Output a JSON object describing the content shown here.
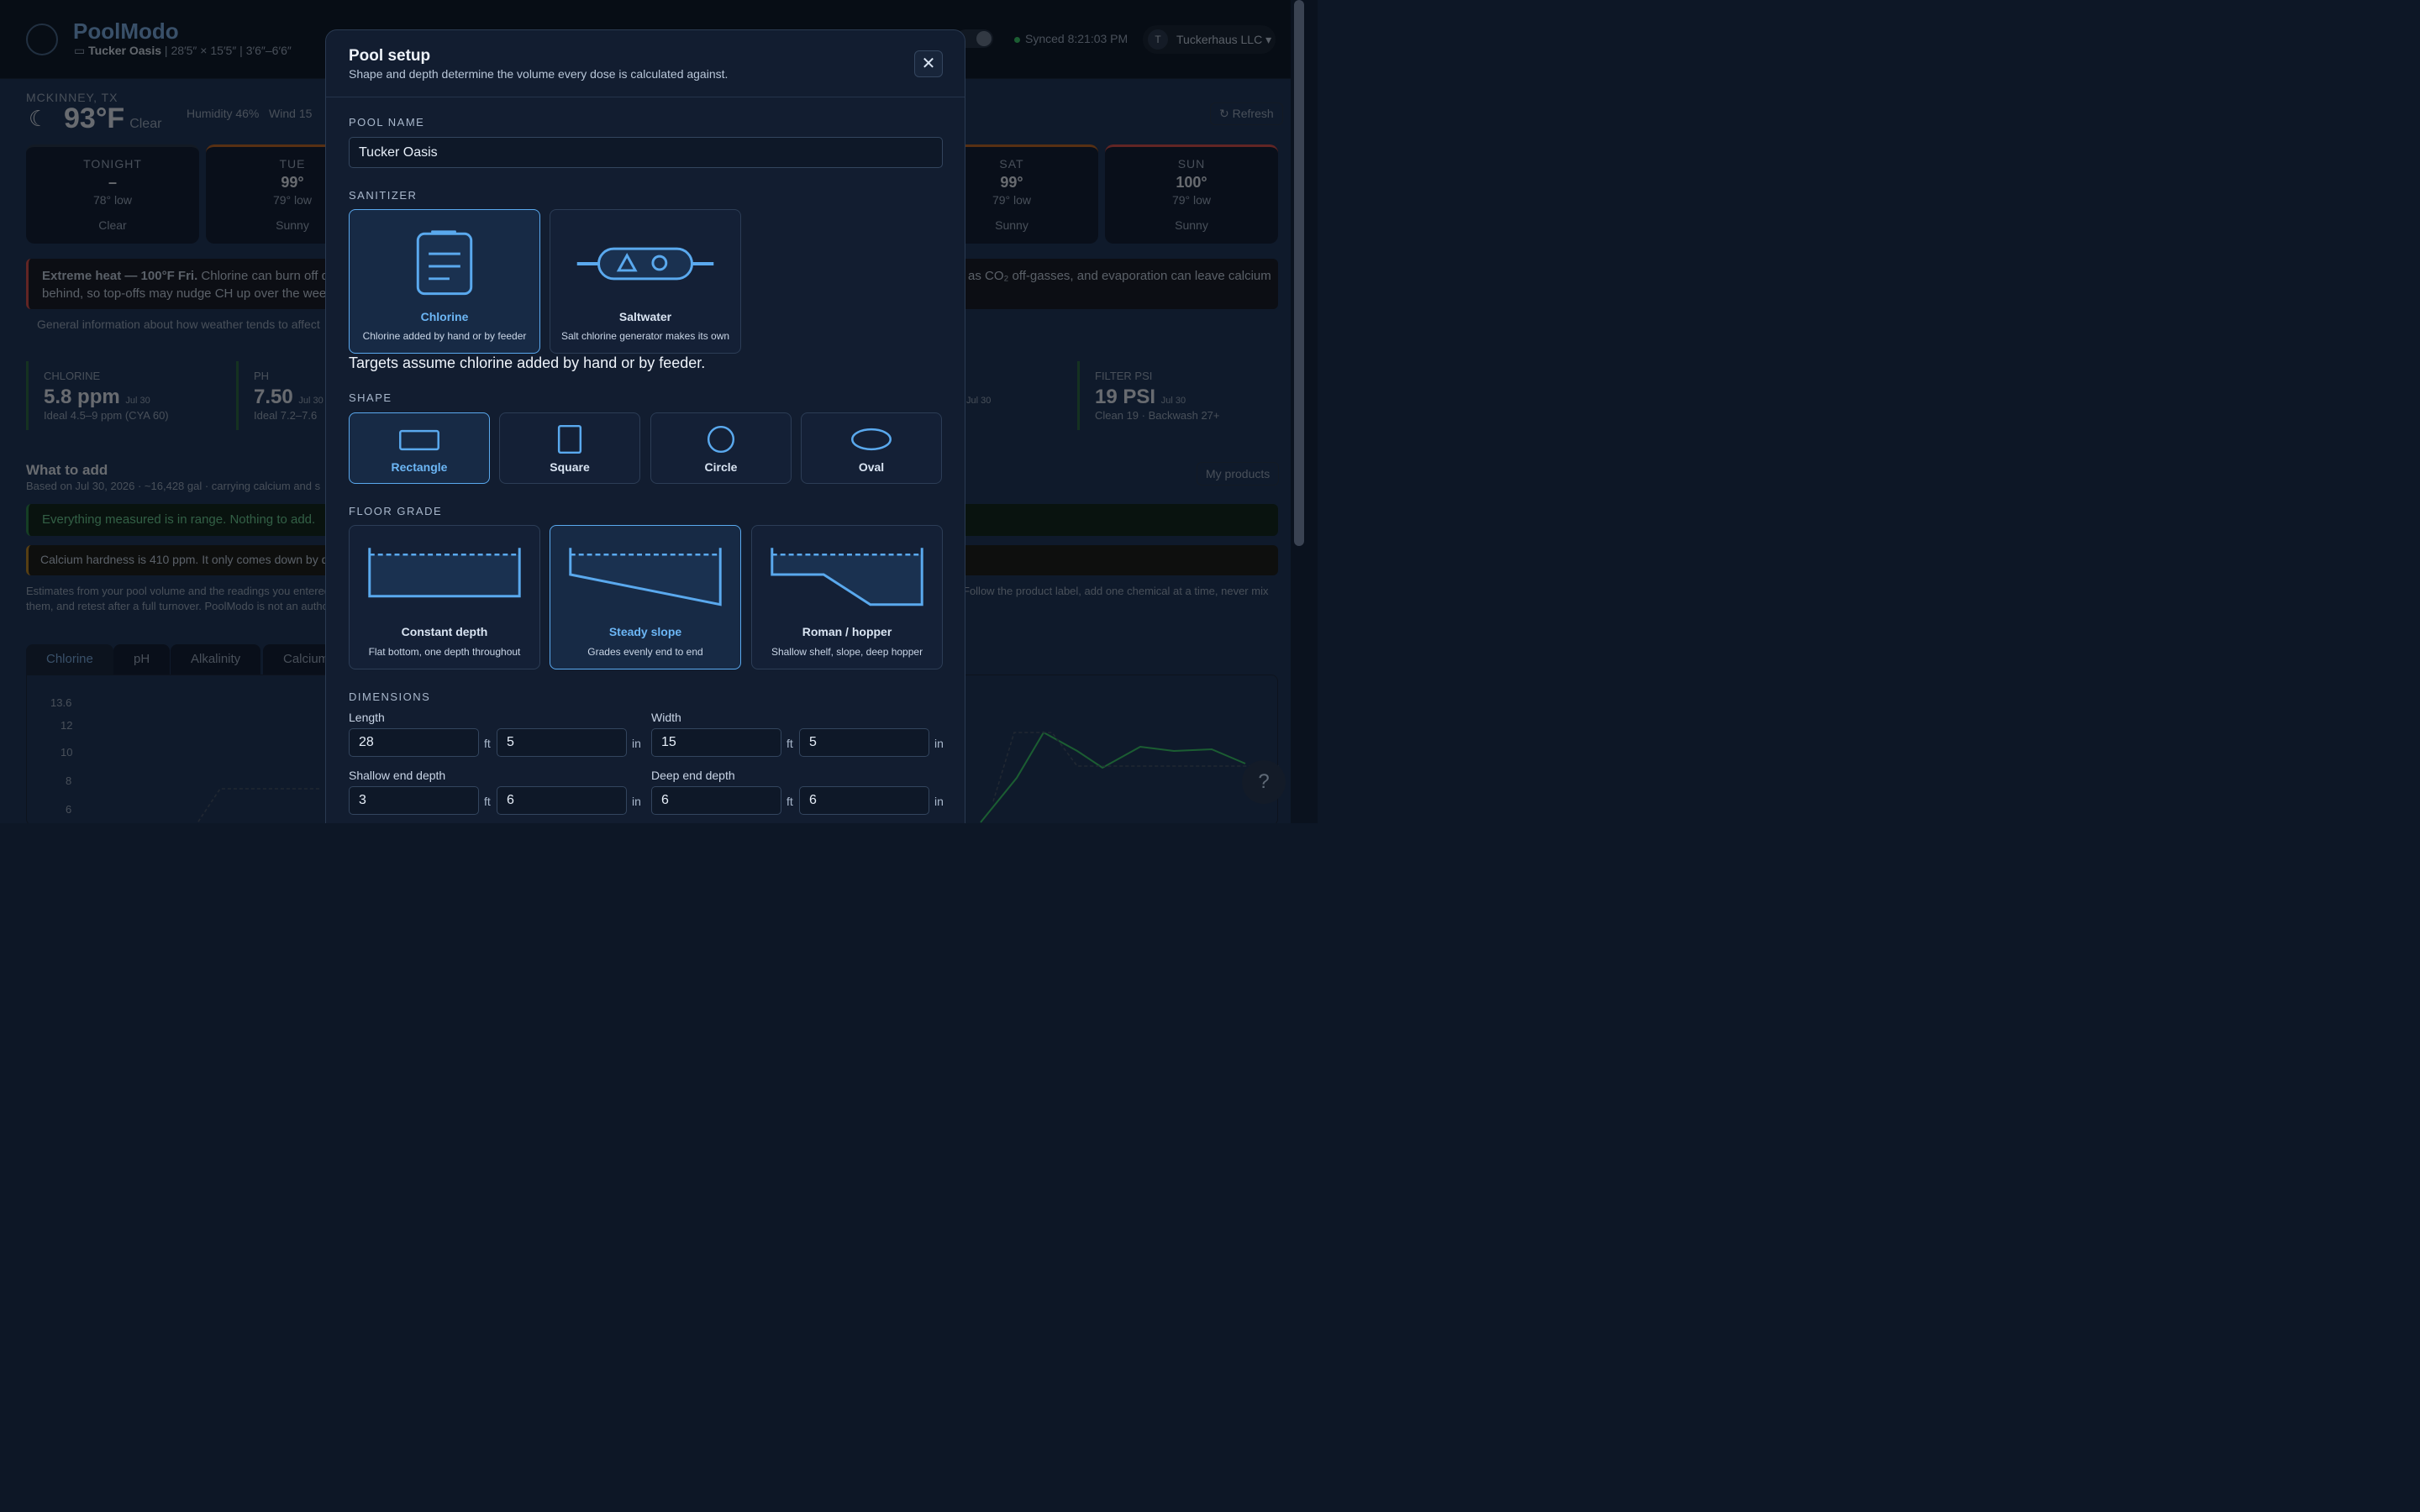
{
  "app": {
    "brand": "PoolModo",
    "pool_label": "Tucker Oasis",
    "dims_text": "28′5″ × 15′5″",
    "depth_text": "3′6″–6′6″",
    "synced": "Synced 8:21:03 PM",
    "account_initial": "T",
    "account_name": "Tuckerhaus LLC"
  },
  "weather": {
    "location": "MCKINNEY, TX",
    "temp": "93°F",
    "cond": "Clear",
    "humidity": "Humidity 46%",
    "wind": "Wind 15",
    "refresh": "↻ Refresh",
    "days": [
      {
        "name": "TONIGHT",
        "hi": "–",
        "lo": "78° low",
        "cond": "Clear"
      },
      {
        "name": "TUE",
        "hi": "99°",
        "lo": "79° low",
        "cond": "Sunny"
      },
      {
        "name": "SAT",
        "hi": "99°",
        "lo": "79° low",
        "cond": "Sunny"
      },
      {
        "name": "SUN",
        "hi": "100°",
        "lo": "79° low",
        "cond": "Sunny"
      }
    ],
    "alert_title": "Extreme heat — 100°F Fri.",
    "alert_text": "Chlorine can burn off q",
    "alert_text2": "behind, so top-offs may nudge CH up over the wee",
    "alert_right": "as CO₂ off-gasses, and evaporation can leave calcium",
    "general_info": "General information about how weather tends to affect"
  },
  "metrics": [
    {
      "label": "CHLORINE",
      "value": "5.8 ppm",
      "date": "Jul 30",
      "ideal": "Ideal 4.5–9 ppm (CYA 60)"
    },
    {
      "label": "PH",
      "value": "7.50",
      "date": "Jul 30",
      "ideal": "Ideal 7.2–7.6"
    },
    {
      "label": "FILTER PSI",
      "value": "19 PSI",
      "date": "Jul 30",
      "ideal": "Clean 19 · Backwash 27+"
    }
  ],
  "metric_extra_date": "Jul 30",
  "add": {
    "title": "What to add",
    "based": "Based on Jul 30, 2026 · ~16,428 gal · carrying calcium and s",
    "my_products": "My products",
    "ok": "Everything measured is in range. Nothing to add.",
    "calcium": "Calcium hardness is 410 ppm. It only comes down by d",
    "estimates": "Estimates from your pool volume and the readings you entered",
    "estimates_right": "Follow the product label, add one chemical at a time, never mix",
    "estimates2": "them, and retest after a full turnover. PoolModo is not an autho"
  },
  "chart_tabs": [
    "Chlorine",
    "pH",
    "Alkalinity",
    "Calcium"
  ],
  "chart_data": {
    "type": "line",
    "y_ticks": [
      "13.6",
      "12",
      "10",
      "8",
      "6"
    ]
  },
  "modal": {
    "title": "Pool setup",
    "subtitle": "Shape and depth determine the volume every dose is calculated against.",
    "close": "✕",
    "pool_name_label": "POOL NAME",
    "pool_name_value": "Tucker Oasis",
    "sanitizer_label": "SANITIZER",
    "sanitizers": [
      {
        "name": "Chlorine",
        "desc": "Chlorine added by hand or by feeder",
        "selected": true
      },
      {
        "name": "Saltwater",
        "desc": "Salt chlorine generator makes its own",
        "selected": false
      }
    ],
    "sanitizer_note": "Targets assume chlorine added by hand or by feeder.",
    "shape_label": "SHAPE",
    "shapes": [
      {
        "name": "Rectangle",
        "selected": true
      },
      {
        "name": "Square",
        "selected": false
      },
      {
        "name": "Circle",
        "selected": false
      },
      {
        "name": "Oval",
        "selected": false
      }
    ],
    "floor_label": "FLOOR GRADE",
    "floors": [
      {
        "name": "Constant depth",
        "desc": "Flat bottom, one depth throughout",
        "selected": false
      },
      {
        "name": "Steady slope",
        "desc": "Grades evenly end to end",
        "selected": true
      },
      {
        "name": "Roman / hopper",
        "desc": "Shallow shelf, slope, deep hopper",
        "selected": false
      }
    ],
    "dims_label": "DIMENSIONS",
    "length_label": "Length",
    "width_label": "Width",
    "shallow_label": "Shallow end depth",
    "deep_label": "Deep end depth",
    "length_ft": "28",
    "length_in": "5",
    "width_ft": "15",
    "width_in": "5",
    "shallow_ft": "3",
    "shallow_in": "6",
    "deep_ft": "6",
    "deep_in": "6",
    "unit_ft": "ft",
    "unit_in": "in"
  },
  "help": "?"
}
